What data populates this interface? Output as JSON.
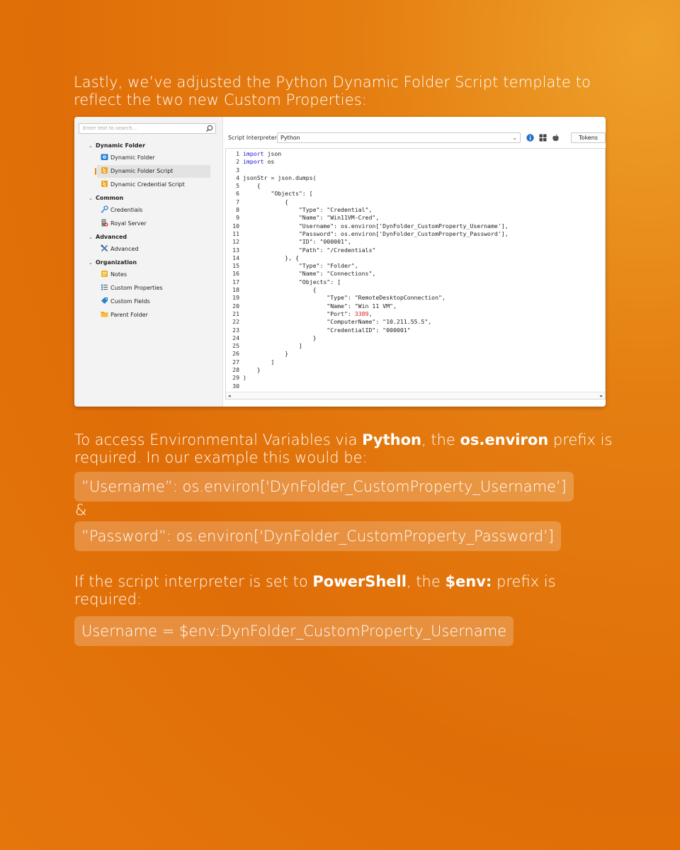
{
  "intro": "Lastly, we’ve adjusted the Python Dynamic Folder Script template to reflect the two new Custom Properties:",
  "window": {
    "search_placeholder": "Enter text to search...",
    "groups": [
      {
        "label": "Dynamic Folder",
        "items": [
          "Dynamic Folder",
          "Dynamic Folder Script",
          "Dynamic Credential Script"
        ]
      },
      {
        "label": "Common",
        "items": [
          "Credentials",
          "Royal Server"
        ]
      },
      {
        "label": "Advanced",
        "items": [
          "Advanced"
        ]
      },
      {
        "label": "Organization",
        "items": [
          "Notes",
          "Custom Properties",
          "Custom Fields",
          "Parent Folder"
        ]
      }
    ],
    "selected_item": "Dynamic Folder Script",
    "script_interpreter_label": "Script Interpreter",
    "script_interpreter_value": "Python",
    "tokens_label": "Tokens",
    "code_lines": [
      "import json",
      "import os",
      "",
      "jsonStr = json.dumps(",
      "    {",
      "        \"Objects\": [",
      "            {",
      "                \"Type\": \"Credential\",",
      "                \"Name\": \"Win11VM-Cred\",",
      "                \"Username\": os.environ['DynFolder_CustomProperty_Username'],",
      "                \"Password\": os.environ['DynFolder_CustomProperty_Password'],",
      "                \"ID\": \"000001\",",
      "                \"Path\": \"/Credentials\"",
      "            }, {",
      "                \"Type\": \"Folder\",",
      "                \"Name\": \"Connections\",",
      "                \"Objects\": [",
      "                    {",
      "                        \"Type\": \"RemoteDesktopConnection\",",
      "                        \"Name\": \"Win 11 VM\",",
      "                        \"Port\": 3389,",
      "                        \"ComputerName\": \"10.211.55.5\",",
      "                        \"CredentialID\": \"000001\"",
      "                    }",
      "                ]",
      "            }",
      "        ]",
      "    }",
      ")",
      ""
    ]
  },
  "python_para": {
    "part1": "To access Environmental Variables via ",
    "bold1": "Python",
    "part2": ", the ",
    "bold2": "os.environ",
    "part3": " prefix is required. In our example this would be:"
  },
  "username_example": "”Username”: os.environ['DynFolder_CustomProperty_Username’]",
  "ampersand": "&",
  "password_example": "”Password”: os.environ['DynFolder_CustomProperty_Password’]",
  "ps_para": {
    "part1": "If the script interpreter is set to ",
    "bold1": "PowerShell",
    "part2": ", the ",
    "bold2": "$env:",
    "part3": " prefix is required:"
  },
  "ps_example": "Username = $env:DynFolder_CustomProperty_Username",
  "colors": {
    "background": "#e06e08",
    "accent": "#f08a00",
    "keyword": "#1a1ac8",
    "number": "#d21f1f"
  }
}
